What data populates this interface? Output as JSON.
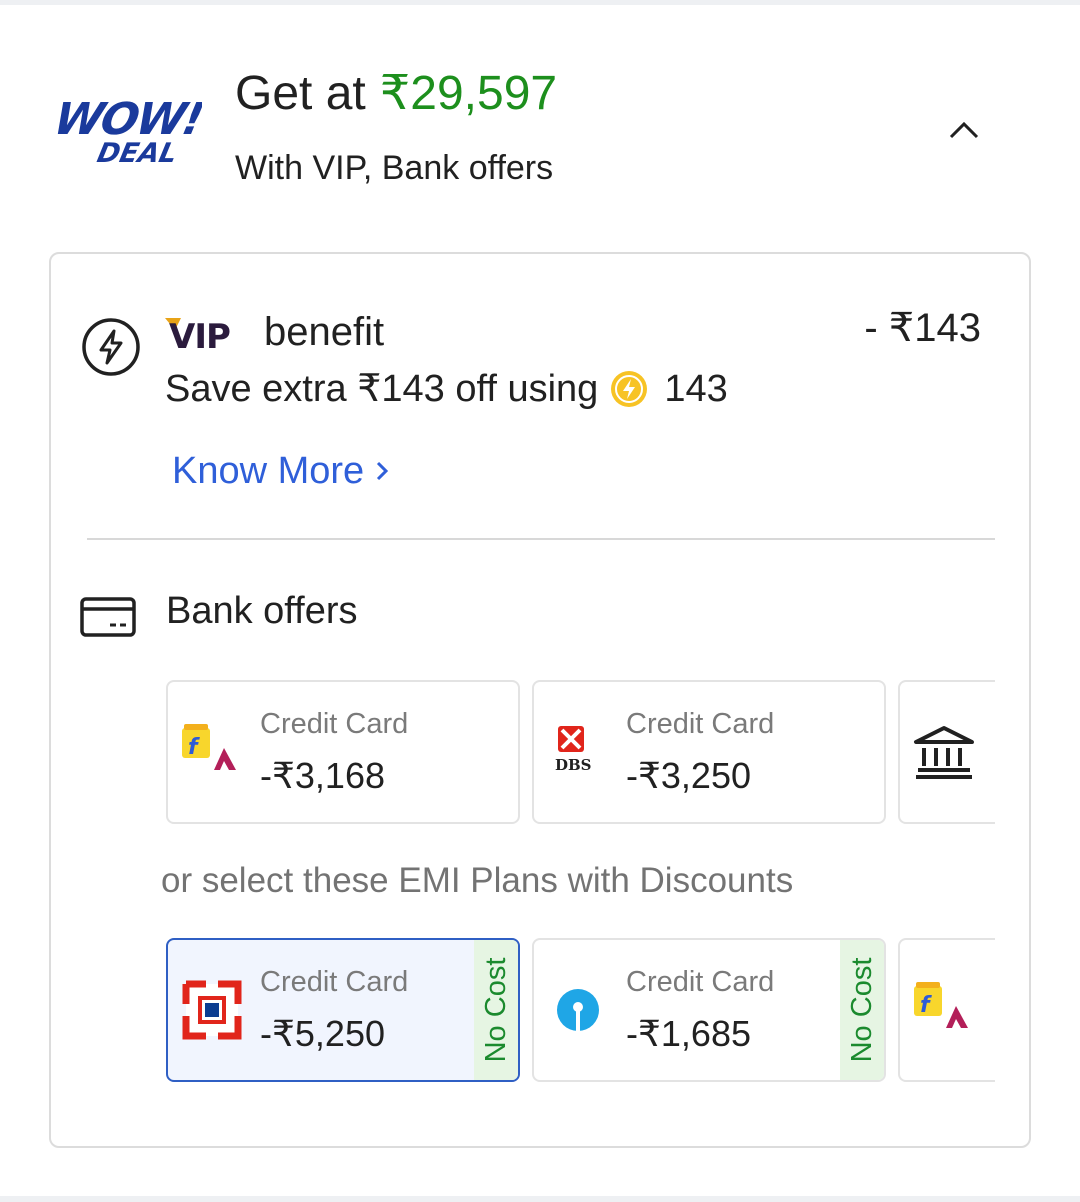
{
  "header": {
    "title_prefix": "Get at",
    "price": "₹29,597",
    "subtitle": "With VIP, Bank offers",
    "logo_text_top": "WOW!",
    "logo_text_bottom": "DEAL",
    "collapse_icon": "chevron-up-icon"
  },
  "vip": {
    "icon": "lightning-circle-icon",
    "logo_text": "VIP",
    "title": "benefit",
    "amount": "- ₹143",
    "description": "Save extra ₹143 off using",
    "coin_icon": "supercoin-icon",
    "coins": "143",
    "know_more": "Know More"
  },
  "bank_offers": {
    "icon": "card-icon",
    "title": "Bank offers",
    "tiles": [
      {
        "logo": "flipkart-axis-logo",
        "label": "Credit Card",
        "value": "-₹3,168"
      },
      {
        "logo": "dbs-logo",
        "label": "Credit Card",
        "value": "-₹3,250"
      },
      {
        "logo": "bank-building-icon",
        "label": "",
        "value": ""
      }
    ]
  },
  "emi": {
    "caption": "or select these EMI Plans with Discounts",
    "tiles": [
      {
        "logo": "hdfc-logo",
        "label": "Credit Card",
        "value": "-₹5,250",
        "tag": "No Cost",
        "selected": true
      },
      {
        "logo": "sbi-logo",
        "label": "Credit Card",
        "value": "-₹1,685",
        "tag": "No Cost",
        "selected": false
      },
      {
        "logo": "flipkart-axis-logo",
        "label": "",
        "value": "",
        "selected": false
      }
    ]
  },
  "colors": {
    "price_green": "#1d8f1d",
    "link_blue": "#2f5fd9",
    "selected_border": "#2f5fc4",
    "nocost_bg": "#e6f5e3",
    "nocost_text": "#1b8a2e",
    "wow_blue": "#1a3a9c"
  }
}
